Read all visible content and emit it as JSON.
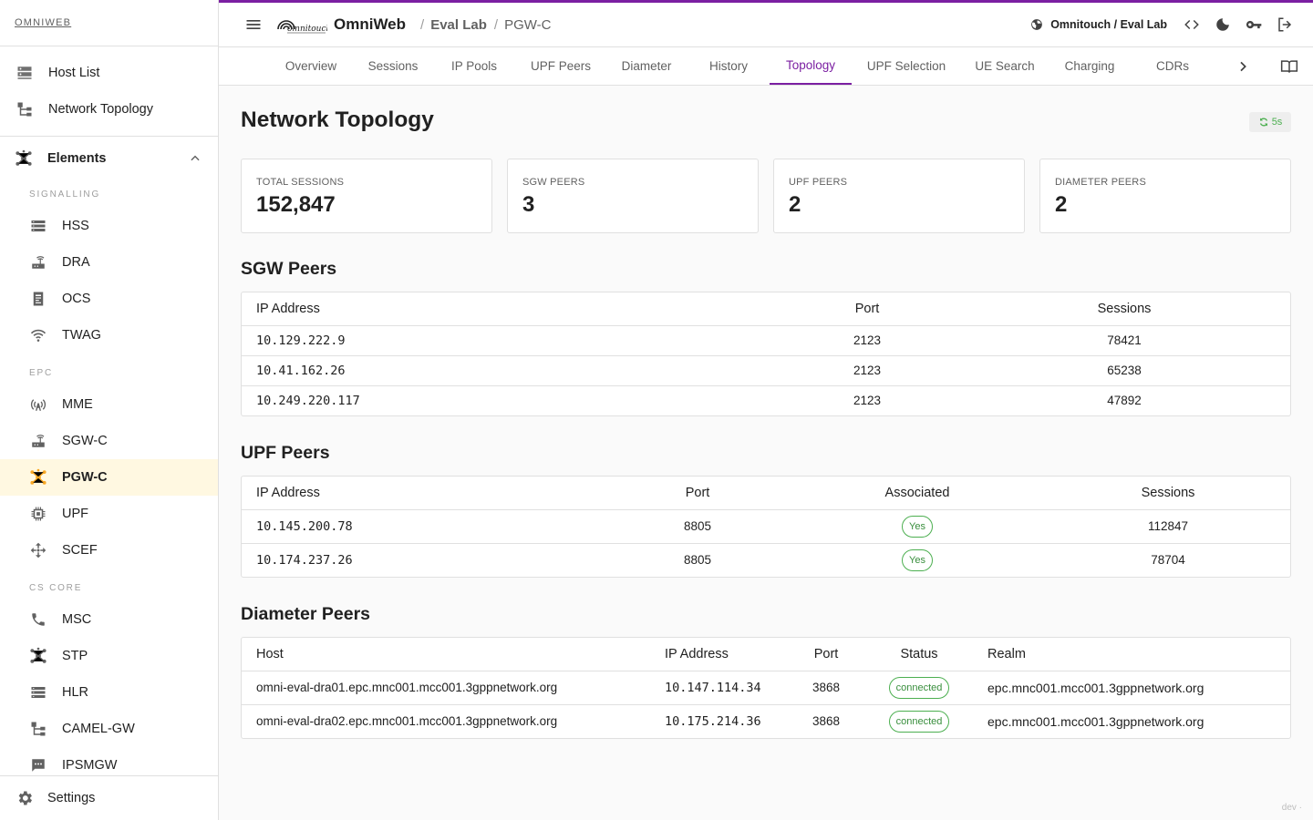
{
  "brand": "OMNIWEB",
  "sidebar": {
    "top_items": [
      {
        "label": "Host List",
        "icon": "server-list-icon"
      },
      {
        "label": "Network Topology",
        "icon": "topology-icon"
      }
    ],
    "group": {
      "label": "Elements",
      "icon": "hub-icon",
      "expanded": true
    },
    "sections": {
      "signalling": "SIGNALLING",
      "epc": "EPC",
      "cs_core": "CS CORE"
    },
    "signalling_items": [
      {
        "label": "HSS",
        "icon": "storage-icon"
      },
      {
        "label": "DRA",
        "icon": "router-icon"
      },
      {
        "label": "OCS",
        "icon": "billing-icon"
      },
      {
        "label": "TWAG",
        "icon": "wifi-icon"
      }
    ],
    "epc_items": [
      {
        "label": "MME",
        "icon": "antenna-icon"
      },
      {
        "label": "SGW-C",
        "icon": "router-icon"
      },
      {
        "label": "PGW-C",
        "icon": "hub-icon",
        "active": true
      },
      {
        "label": "UPF",
        "icon": "chip-icon"
      },
      {
        "label": "SCEF",
        "icon": "move-arrows-icon"
      }
    ],
    "cs_items": [
      {
        "label": "MSC",
        "icon": "phone-icon"
      },
      {
        "label": "STP",
        "icon": "hub-icon"
      },
      {
        "label": "HLR",
        "icon": "storage-icon"
      },
      {
        "label": "CAMEL-GW",
        "icon": "topology-icon"
      },
      {
        "label": "IPSMGW",
        "icon": "sms-icon"
      }
    ],
    "settings": "Settings"
  },
  "topbar": {
    "app_name": "OmniWeb",
    "breadcrumb": [
      "Eval Lab",
      "PGW-C"
    ],
    "tenant": "Omnitouch / Eval Lab"
  },
  "tabs": [
    {
      "label": "Overview"
    },
    {
      "label": "Sessions"
    },
    {
      "label": "IP Pools"
    },
    {
      "label": "UPF Peers"
    },
    {
      "label": "Diameter"
    },
    {
      "label": "History"
    },
    {
      "label": "Topology",
      "active": true
    },
    {
      "label": "UPF Selection"
    },
    {
      "label": "UE Search"
    },
    {
      "label": "Charging"
    },
    {
      "label": "CDRs"
    }
  ],
  "main": {
    "title": "Network Topology",
    "refresh": "5s",
    "stats": [
      {
        "label": "TOTAL SESSIONS",
        "value": "152,847"
      },
      {
        "label": "SGW PEERS",
        "value": "3"
      },
      {
        "label": "UPF PEERS",
        "value": "2"
      },
      {
        "label": "DIAMETER PEERS",
        "value": "2"
      }
    ],
    "sgw": {
      "title": "SGW Peers",
      "headers": [
        "IP Address",
        "Port",
        "Sessions"
      ],
      "rows": [
        [
          "10.129.222.9",
          "2123",
          "78421"
        ],
        [
          "10.41.162.26",
          "2123",
          "65238"
        ],
        [
          "10.249.220.117",
          "2123",
          "47892"
        ]
      ]
    },
    "upf": {
      "title": "UPF Peers",
      "headers": [
        "IP Address",
        "Port",
        "Associated",
        "Sessions"
      ],
      "rows": [
        [
          "10.145.200.78",
          "8805",
          "Yes",
          "112847"
        ],
        [
          "10.174.237.26",
          "8805",
          "Yes",
          "78704"
        ]
      ]
    },
    "diameter": {
      "title": "Diameter Peers",
      "headers": [
        "Host",
        "IP Address",
        "Port",
        "Status",
        "Realm"
      ],
      "rows": [
        [
          "omni-eval-dra01.epc.mnc001.mcc001.3gppnetwork.org",
          "10.147.114.34",
          "3868",
          "connected",
          "epc.mnc001.mcc001.3gppnetwork.org"
        ],
        [
          "omni-eval-dra02.epc.mnc001.mcc001.3gppnetwork.org",
          "10.175.214.36",
          "3868",
          "connected",
          "epc.mnc001.mcc001.3gppnetwork.org"
        ]
      ]
    }
  },
  "footer": {
    "env": "dev ·"
  },
  "colors": {
    "accent": "#7b1fa2",
    "active_icon": "#f9a825",
    "success": "#4caf50"
  }
}
